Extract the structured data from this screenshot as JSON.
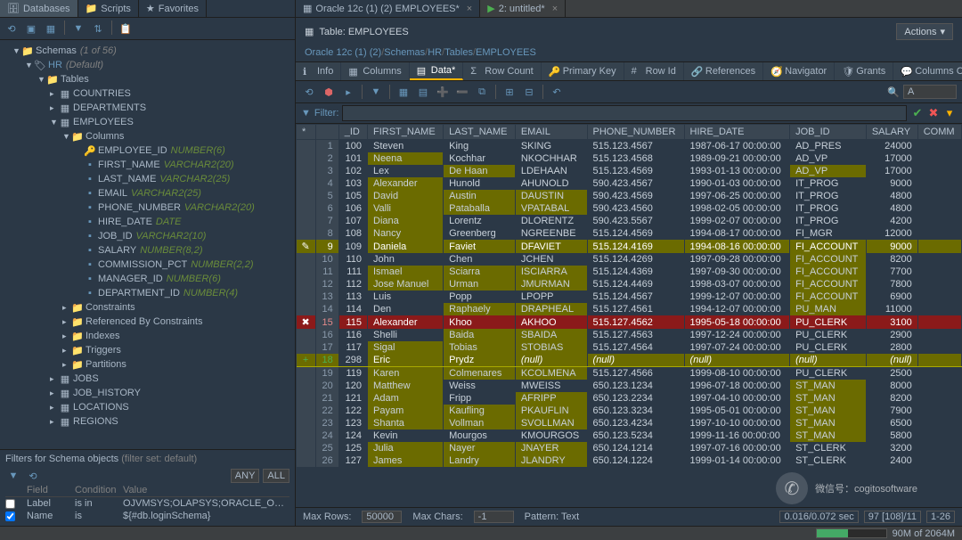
{
  "sidebar": {
    "tabs": [
      "Databases",
      "Scripts",
      "Favorites"
    ],
    "schemas_header": "Schemas",
    "schemas_hint": "(1 of 56)",
    "schema_name": "HR",
    "schema_hint": "(Default)",
    "tables_label": "Tables",
    "tables": [
      "COUNTRIES",
      "DEPARTMENTS",
      "EMPLOYEES",
      "JOBS",
      "JOB_HISTORY",
      "LOCATIONS",
      "REGIONS"
    ],
    "columns_label": "Columns",
    "columns": [
      {
        "name": "EMPLOYEE_ID",
        "type": "NUMBER(6)",
        "pk": true
      },
      {
        "name": "FIRST_NAME",
        "type": "VARCHAR2(20)"
      },
      {
        "name": "LAST_NAME",
        "type": "VARCHAR2(25)"
      },
      {
        "name": "EMAIL",
        "type": "VARCHAR2(25)"
      },
      {
        "name": "PHONE_NUMBER",
        "type": "VARCHAR2(20)"
      },
      {
        "name": "HIRE_DATE",
        "type": "DATE"
      },
      {
        "name": "JOB_ID",
        "type": "VARCHAR2(10)"
      },
      {
        "name": "SALARY",
        "type": "NUMBER(8,2)"
      },
      {
        "name": "COMMISSION_PCT",
        "type": "NUMBER(2,2)"
      },
      {
        "name": "MANAGER_ID",
        "type": "NUMBER(6)"
      },
      {
        "name": "DEPARTMENT_ID",
        "type": "NUMBER(4)"
      }
    ],
    "folders": [
      "Constraints",
      "Referenced By Constraints",
      "Indexes",
      "Triggers",
      "Partitions"
    ]
  },
  "filter_panel": {
    "title": "Filters for Schema objects",
    "hint": "(filter set: default)",
    "any": "ANY",
    "all": "ALL",
    "headers": [
      "",
      "Field",
      "Condition",
      "Value"
    ],
    "rows": [
      {
        "field": "Label",
        "cond": "is in",
        "value": "OJVMSYS;OLAPSYS;ORACLE_OCM;ORDDATA..."
      },
      {
        "field": "Name",
        "cond": "is",
        "value": "${#db.loginSchema}"
      }
    ]
  },
  "content": {
    "tabs": [
      {
        "label": "Oracle 12c (1) (2) EMPLOYEES*",
        "active": true
      },
      {
        "label": "2: untitled*"
      }
    ],
    "title": "Table: EMPLOYEES",
    "breadcrumb": [
      "Oracle 12c (1) (2)",
      "Schemas",
      "HR",
      "Tables",
      "EMPLOYEES"
    ],
    "subtabs": [
      "Info",
      "Columns",
      "Data*",
      "Row Count",
      "Primary Key",
      "Row Id",
      "References",
      "Navigator",
      "Grants",
      "Columns Comm"
    ],
    "actions_label": "Actions",
    "search_value": "A",
    "filter_label": "Filter:",
    "data_headers": [
      "",
      "_ID",
      "FIRST_NAME",
      "LAST_NAME",
      "EMAIL",
      "PHONE_NUMBER",
      "HIRE_DATE",
      "JOB_ID",
      "SALARY",
      "COMM"
    ],
    "rows": [
      {
        "n": 1,
        "id": 100,
        "fn": "Steven",
        "ln": "King",
        "em": "SKING",
        "ph": "515.123.4567",
        "hd": "1987-06-17 00:00:00",
        "job": "AD_PRES",
        "sal": 24000
      },
      {
        "n": 2,
        "id": 101,
        "fn": "Neena",
        "ln": "Kochhar",
        "em": "NKOCHHAR",
        "ph": "515.123.4568",
        "hd": "1989-09-21 00:00:00",
        "job": "AD_VP",
        "sal": 17000,
        "hl": [
          "fn"
        ]
      },
      {
        "n": 3,
        "id": 102,
        "fn": "Lex",
        "ln": "De Haan",
        "em": "LDEHAAN",
        "ph": "515.123.4569",
        "hd": "1993-01-13 00:00:00",
        "job": "AD_VP",
        "sal": 17000,
        "hl": [
          "ln",
          "job"
        ]
      },
      {
        "n": 4,
        "id": 103,
        "fn": "Alexander",
        "ln": "Hunold",
        "em": "AHUNOLD",
        "ph": "590.423.4567",
        "hd": "1990-01-03 00:00:00",
        "job": "IT_PROG",
        "sal": 9000,
        "hl": [
          "fn"
        ]
      },
      {
        "n": 5,
        "id": 105,
        "fn": "David",
        "ln": "Austin",
        "em": "DAUSTIN",
        "ph": "590.423.4569",
        "hd": "1997-06-25 00:00:00",
        "job": "IT_PROG",
        "sal": 4800,
        "hl": [
          "fn",
          "ln",
          "em"
        ]
      },
      {
        "n": 6,
        "id": 106,
        "fn": "Valli",
        "ln": "Pataballa",
        "em": "VPATABAL",
        "ph": "590.423.4560",
        "hd": "1998-02-05 00:00:00",
        "job": "IT_PROG",
        "sal": 4800,
        "hl": [
          "fn",
          "ln",
          "em"
        ]
      },
      {
        "n": 7,
        "id": 107,
        "fn": "Diana",
        "ln": "Lorentz",
        "em": "DLORENTZ",
        "ph": "590.423.5567",
        "hd": "1999-02-07 00:00:00",
        "job": "IT_PROG",
        "sal": 4200,
        "hl": [
          "fn"
        ]
      },
      {
        "n": 8,
        "id": 108,
        "fn": "Nancy",
        "ln": "Greenberg",
        "em": "NGREENBE",
        "ph": "515.124.4569",
        "hd": "1994-08-17 00:00:00",
        "job": "FI_MGR",
        "sal": 12000,
        "hl": [
          "fn"
        ]
      },
      {
        "n": 9,
        "id": 109,
        "fn": "Daniela",
        "ln": "Faviet",
        "em": "DFAVIET",
        "ph": "515.124.4169",
        "hd": "1994-08-16 00:00:00",
        "job": "FI_ACCOUNT",
        "sal": 9000,
        "dirty": true,
        "hlrow": true
      },
      {
        "n": 10,
        "id": 110,
        "fn": "John",
        "ln": "Chen",
        "em": "JCHEN",
        "ph": "515.124.4269",
        "hd": "1997-09-28 00:00:00",
        "job": "FI_ACCOUNT",
        "sal": 8200,
        "hl": [
          "job"
        ]
      },
      {
        "n": 11,
        "id": 111,
        "fn": "Ismael",
        "ln": "Sciarra",
        "em": "ISCIARRA",
        "ph": "515.124.4369",
        "hd": "1997-09-30 00:00:00",
        "job": "FI_ACCOUNT",
        "sal": 7700,
        "hl": [
          "fn",
          "ln",
          "em",
          "job"
        ]
      },
      {
        "n": 12,
        "id": 112,
        "fn": "Jose Manuel",
        "ln": "Urman",
        "em": "JMURMAN",
        "ph": "515.124.4469",
        "hd": "1998-03-07 00:00:00",
        "job": "FI_ACCOUNT",
        "sal": 7800,
        "hl": [
          "fn",
          "ln",
          "em",
          "job"
        ]
      },
      {
        "n": 13,
        "id": 113,
        "fn": "Luis",
        "ln": "Popp",
        "em": "LPOPP",
        "ph": "515.124.4567",
        "hd": "1999-12-07 00:00:00",
        "job": "FI_ACCOUNT",
        "sal": 6900,
        "hl": [
          "job"
        ]
      },
      {
        "n": 14,
        "id": 114,
        "fn": "Den",
        "ln": "Raphaely",
        "em": "DRAPHEAL",
        "ph": "515.127.4561",
        "hd": "1994-12-07 00:00:00",
        "job": "PU_MAN",
        "sal": 11000,
        "hl": [
          "ln",
          "em",
          "job"
        ]
      },
      {
        "n": 15,
        "id": 115,
        "fn": "Alexander",
        "ln": "Khoo",
        "em": "AKHOO",
        "ph": "515.127.4562",
        "hd": "1995-05-18 00:00:00",
        "job": "PU_CLERK",
        "sal": 3100,
        "del": true
      },
      {
        "n": 16,
        "id": 116,
        "fn": "Shelli",
        "ln": "Baida",
        "em": "SBAIDA",
        "ph": "515.127.4563",
        "hd": "1997-12-24 00:00:00",
        "job": "PU_CLERK",
        "sal": 2900,
        "hl": [
          "ln",
          "em"
        ]
      },
      {
        "n": 17,
        "id": 117,
        "fn": "Sigal",
        "ln": "Tobias",
        "em": "STOBIAS",
        "ph": "515.127.4564",
        "hd": "1997-07-24 00:00:00",
        "job": "PU_CLERK",
        "sal": 2800,
        "hl": [
          "fn",
          "ln",
          "em"
        ]
      },
      {
        "n": 18,
        "id": 298,
        "fn": "Eric",
        "ln": "Prydz",
        "em": "(null)",
        "ph": "(null)",
        "hd": "(null)",
        "job": "(null)",
        "sal": "(null)",
        "new": true,
        "hlrow": true
      },
      {
        "n": 19,
        "id": 119,
        "fn": "Karen",
        "ln": "Colmenares",
        "em": "KCOLMENA",
        "ph": "515.127.4566",
        "hd": "1999-08-10 00:00:00",
        "job": "PU_CLERK",
        "sal": 2500,
        "hl": [
          "fn",
          "ln",
          "em"
        ]
      },
      {
        "n": 20,
        "id": 120,
        "fn": "Matthew",
        "ln": "Weiss",
        "em": "MWEISS",
        "ph": "650.123.1234",
        "hd": "1996-07-18 00:00:00",
        "job": "ST_MAN",
        "sal": 8000,
        "hl": [
          "fn",
          "job"
        ]
      },
      {
        "n": 21,
        "id": 121,
        "fn": "Adam",
        "ln": "Fripp",
        "em": "AFRIPP",
        "ph": "650.123.2234",
        "hd": "1997-04-10 00:00:00",
        "job": "ST_MAN",
        "sal": 8200,
        "hl": [
          "fn",
          "em",
          "job"
        ]
      },
      {
        "n": 22,
        "id": 122,
        "fn": "Payam",
        "ln": "Kaufling",
        "em": "PKAUFLIN",
        "ph": "650.123.3234",
        "hd": "1995-05-01 00:00:00",
        "job": "ST_MAN",
        "sal": 7900,
        "hl": [
          "fn",
          "ln",
          "em",
          "job"
        ]
      },
      {
        "n": 23,
        "id": 123,
        "fn": "Shanta",
        "ln": "Vollman",
        "em": "SVOLLMAN",
        "ph": "650.123.4234",
        "hd": "1997-10-10 00:00:00",
        "job": "ST_MAN",
        "sal": 6500,
        "hl": [
          "fn",
          "ln",
          "em",
          "job"
        ]
      },
      {
        "n": 24,
        "id": 124,
        "fn": "Kevin",
        "ln": "Mourgos",
        "em": "KMOURGOS",
        "ph": "650.123.5234",
        "hd": "1999-11-16 00:00:00",
        "job": "ST_MAN",
        "sal": 5800,
        "hl": [
          "job"
        ]
      },
      {
        "n": 25,
        "id": 125,
        "fn": "Julia",
        "ln": "Nayer",
        "em": "JNAYER",
        "ph": "650.124.1214",
        "hd": "1997-07-16 00:00:00",
        "job": "ST_CLERK",
        "sal": 3200,
        "hl": [
          "fn",
          "ln",
          "em"
        ]
      },
      {
        "n": 26,
        "id": 127,
        "fn": "James",
        "ln": "Landry",
        "em": "JLANDRY",
        "ph": "650.124.1224",
        "hd": "1999-01-14 00:00:00",
        "job": "ST_CLERK",
        "sal": 2400,
        "hl": [
          "fn",
          "ln",
          "em"
        ]
      }
    ],
    "status": {
      "max_rows_label": "Max Rows:",
      "max_rows": "50000",
      "max_chars_label": "Max Chars:",
      "max_chars": "-1",
      "pattern_label": "Pattern: Text",
      "timing": "0.016/0.072 sec",
      "pos": "97 [108]/11",
      "range": "1-26"
    }
  },
  "app_status": {
    "mem": "90M of 2064M"
  },
  "watermark": "微信号：cogitosoftware"
}
